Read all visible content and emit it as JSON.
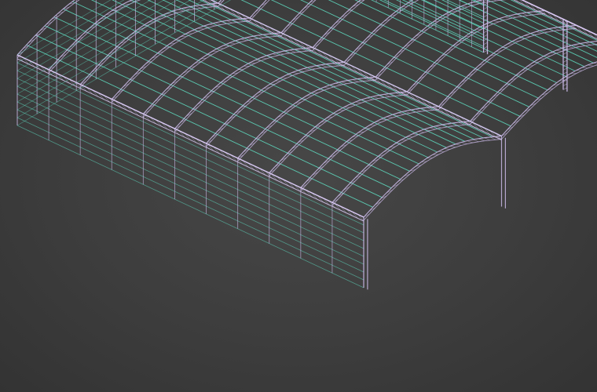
{
  "scene": {
    "subject": "double-arched-truss-canopy-wireframe",
    "colors": {
      "background": "#3c3c3c",
      "truss": "#c9b8e6",
      "purlin": "#5fe0c4",
      "edge": "#d8c8f2"
    }
  }
}
